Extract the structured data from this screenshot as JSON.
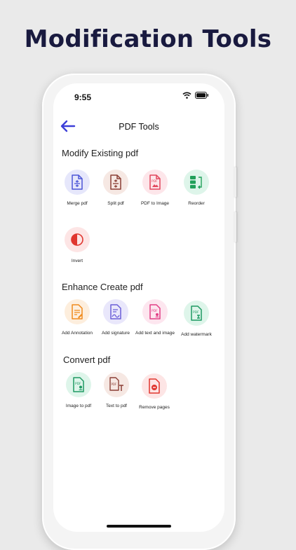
{
  "headline": "Modification Tools",
  "status": {
    "time": "9:55"
  },
  "nav": {
    "title": "PDF Tools"
  },
  "sections": [
    {
      "title": "Modify Existing pdf",
      "tools": [
        {
          "label": "Merge pdf",
          "icon": "merge-pdf-icon",
          "bg": "#e6e7fb",
          "color": "#4b55d6"
        },
        {
          "label": "Split pdf",
          "icon": "split-pdf-icon",
          "bg": "#f6e8e3",
          "color": "#8b3f36"
        },
        {
          "label": "PDF to Image",
          "icon": "pdf-to-image-icon",
          "bg": "#fde6ea",
          "color": "#e2475c"
        },
        {
          "label": "Reorder",
          "icon": "reorder-icon",
          "bg": "#def5ea",
          "color": "#21a05a"
        },
        {
          "label": "Invert",
          "icon": "invert-icon",
          "bg": "#fde5e5",
          "color": "#e0362f"
        }
      ]
    },
    {
      "title": "Enhance Create pdf",
      "tools": [
        {
          "label": "Add Annotation",
          "icon": "add-annotation-icon",
          "bg": "#fdeedd",
          "color": "#f08a1c"
        },
        {
          "label": "Add signature",
          "icon": "add-signature-icon",
          "bg": "#e9e7fb",
          "color": "#6b5fd8"
        },
        {
          "label": "Add text and image",
          "icon": "add-text-image-icon",
          "bg": "#fde6ef",
          "color": "#e23f86"
        },
        {
          "label": "Add watermark",
          "icon": "add-watermark-icon",
          "bg": "#def5ea",
          "color": "#1f9a63"
        }
      ]
    },
    {
      "title": "Convert pdf",
      "tools": [
        {
          "label": "Image to pdf",
          "icon": "image-to-pdf-icon",
          "bg": "#def5ea",
          "color": "#1f9a63"
        },
        {
          "label": "Text to pdf",
          "icon": "text-to-pdf-icon",
          "bg": "#f6e8e3",
          "color": "#8b3f36"
        },
        {
          "label": "Remove pages",
          "icon": "remove-pages-icon",
          "bg": "#fde5e5",
          "color": "#e0362f"
        }
      ]
    }
  ]
}
